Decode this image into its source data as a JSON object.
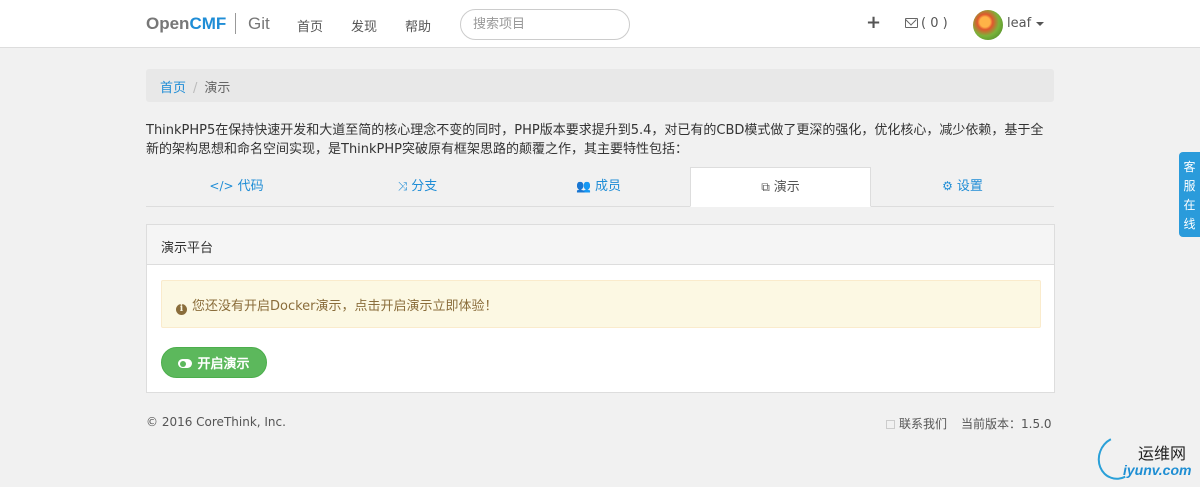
{
  "nav": {
    "brand_open": "Open",
    "brand_cmf": "CMF",
    "brand_git": "Git",
    "links": [
      "首页",
      "发现",
      "帮助"
    ],
    "search_placeholder": "搜索项目",
    "plus": "+",
    "mail_label": "( 0 )",
    "user": "leaf"
  },
  "breadcrumb": {
    "home": "首页",
    "separator": "/",
    "current": "演示"
  },
  "intro": "ThinkPHP5在保持快速开发和大道至简的核心理念不变的同时，PHP版本要求提升到5.4，对已有的CBD模式做了更深的强化，优化核心，减少依赖，基于全新的架构思想和命名空间实现，是ThinkPHP突破原有框架思路的颠覆之作，其主要特性包括：",
  "tabs": [
    {
      "icon": "</>",
      "label": "代码"
    },
    {
      "icon": "⤨",
      "label": "分支"
    },
    {
      "icon": "👥",
      "label": "成员"
    },
    {
      "icon": "⧉",
      "label": "演示"
    },
    {
      "icon": "⚙",
      "label": "设置"
    }
  ],
  "panel": {
    "title": "演示平台",
    "alert_icon": "i",
    "alert": "您还没有开启Docker演示，点击开启演示立即体验！",
    "button": "开启演示"
  },
  "footer": {
    "copyright": "© 2016 CoreThink, Inc.",
    "contact": "联系我们",
    "version": "当前版本：1.5.0"
  },
  "service": [
    "客",
    "服",
    "在",
    "线"
  ],
  "watermark": {
    "top": "运维网",
    "bottom": "iyunv.com"
  },
  "colors": {
    "accent": "#1f8dd6",
    "success": "#5cb85c",
    "alert_bg": "#fcf8e3",
    "service_tab": "#2a9bdb"
  }
}
